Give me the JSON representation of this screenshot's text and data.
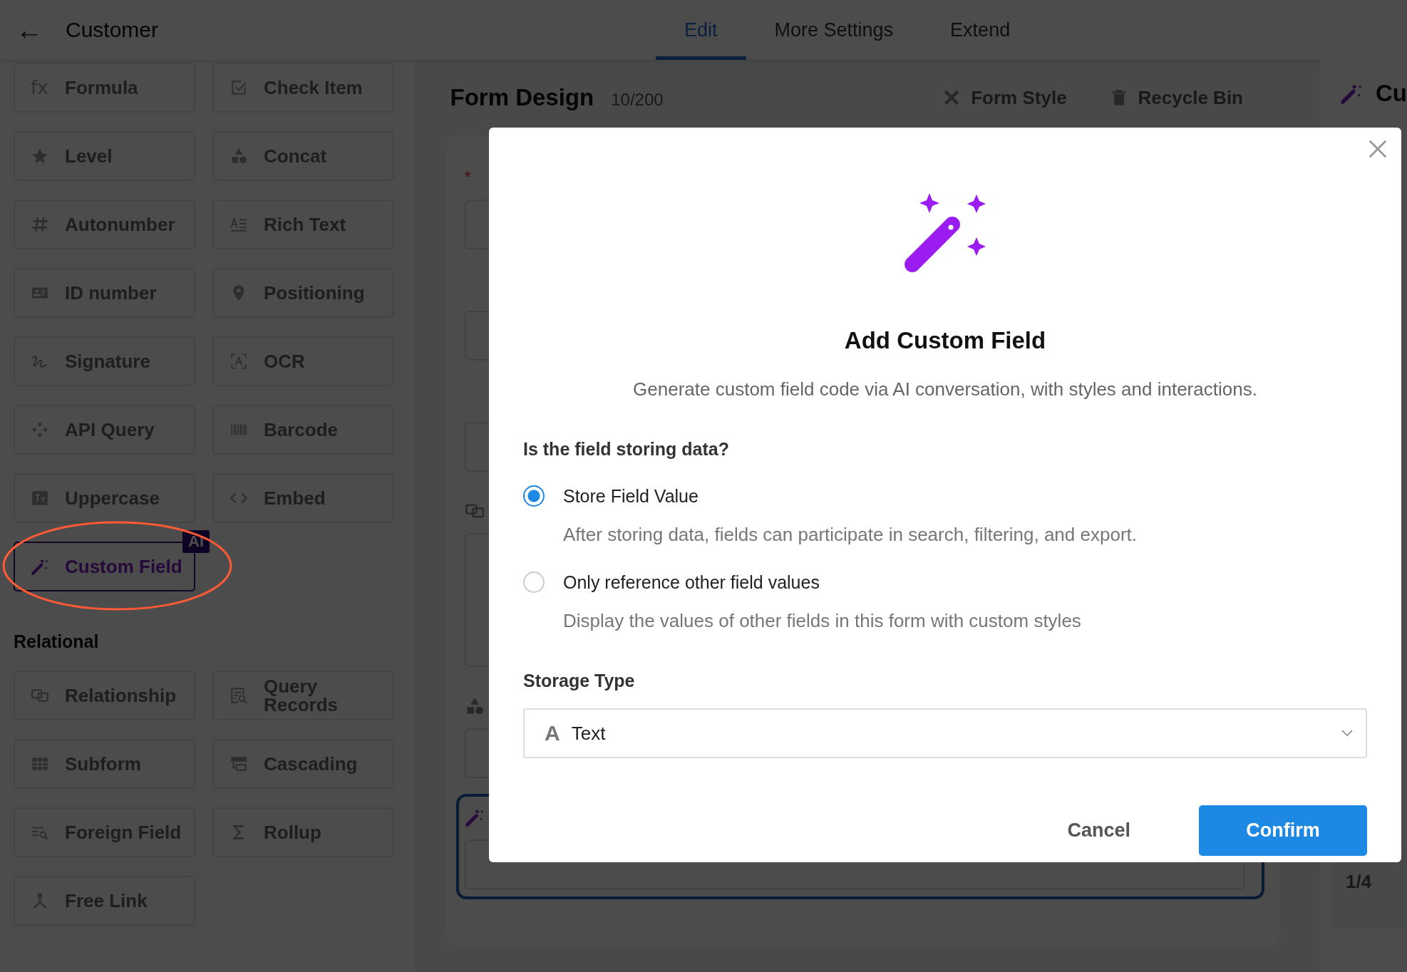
{
  "header": {
    "back": "←",
    "title": "Customer"
  },
  "tabs": [
    {
      "label": "Edit",
      "selected": true
    },
    {
      "label": "More Settings",
      "selected": false
    },
    {
      "label": "Extend",
      "selected": false
    }
  ],
  "sidebar": {
    "groups": [
      {
        "items": [
          {
            "label": "Formula",
            "symbol": "fx",
            "selected": false
          },
          {
            "label": "Check Item",
            "selected": false
          },
          {
            "label": "Level",
            "selected": false
          },
          {
            "label": "Concat",
            "selected": false
          },
          {
            "label": "Autonumber",
            "selected": false
          },
          {
            "label": "Rich Text",
            "selected": false
          },
          {
            "label": "ID number",
            "selected": false
          },
          {
            "label": "Positioning",
            "selected": false
          },
          {
            "label": "Signature",
            "selected": false
          },
          {
            "label": "OCR",
            "selected": false
          },
          {
            "label": "API Query",
            "selected": false
          },
          {
            "label": "Barcode",
            "selected": false
          },
          {
            "label": "Uppercase",
            "selected": false
          },
          {
            "label": "Embed",
            "selected": false
          },
          {
            "label": "Custom Field",
            "selected": true,
            "badge": "AI",
            "circled": true
          }
        ]
      },
      {
        "heading": "Relational",
        "items": [
          {
            "label": "Relationship",
            "selected": false
          },
          {
            "label": "Query Records",
            "selected": false
          },
          {
            "label": "Subform",
            "selected": false
          },
          {
            "label": "Cascading",
            "selected": false
          },
          {
            "label": "Foreign Field",
            "selected": false
          },
          {
            "label": "Rollup",
            "selected": false
          },
          {
            "label": "Free Link",
            "selected": false
          }
        ]
      }
    ]
  },
  "form": {
    "title": "Form Design",
    "count": "10/200",
    "actions": [
      {
        "label": "Form Style"
      },
      {
        "label": "Recycle Bin"
      }
    ],
    "fields": [
      {
        "mark": "*",
        "selected": false,
        "kind": "input"
      },
      {
        "selected": false,
        "kind": "input"
      },
      {
        "selected": false,
        "kind": "input"
      },
      {
        "selected": false,
        "kind": "table"
      },
      {
        "selected": false,
        "kind": "input"
      },
      {
        "selected": true,
        "kind": "input"
      }
    ]
  },
  "right_panel": {
    "title": "Cu",
    "pager": "1/4"
  },
  "dialog": {
    "title": "Add Custom Field",
    "subtitle": "Generate custom field code via AI conversation, with styles and interactions.",
    "question": "Is the field storing data?",
    "options": [
      {
        "label": "Store Field Value",
        "description": "After storing data, fields can participate in search, filtering, and export.",
        "selected": true
      },
      {
        "label": "Only reference other field values",
        "description": "Display the values of other fields in this form with custom styles",
        "selected": false
      }
    ],
    "storage_label": "Storage Type",
    "storage_value": "Text",
    "storage_icon": "A",
    "buttons": [
      {
        "label": "Cancel",
        "kind": "secondary"
      },
      {
        "label": "Confirm",
        "kind": "primary"
      }
    ]
  }
}
